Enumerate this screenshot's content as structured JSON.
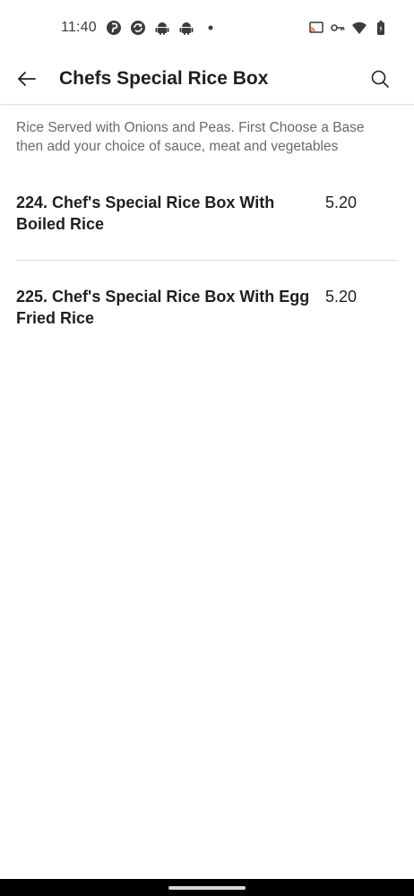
{
  "status_bar": {
    "time": "11:40",
    "left_icons": [
      "pinterest-icon",
      "sync-icon",
      "android-icon",
      "android-icon",
      "dot-icon"
    ],
    "right_icons": [
      "cast-icon",
      "vpn-key-icon",
      "wifi-icon",
      "battery-icon"
    ]
  },
  "header": {
    "title": "Chefs Special Rice Box",
    "back_icon": "arrow-left-icon",
    "search_icon": "search-icon"
  },
  "description": "Rice Served with Onions and Peas. First Choose a Base then add your choice of sauce, meat and vegetables",
  "items": [
    {
      "name": "224. Chef's Special Rice Box With Boiled Rice",
      "price": "5.20"
    },
    {
      "name": "225. Chef's Special Rice Box With Egg Fried Rice",
      "price": "5.20"
    }
  ],
  "colors": {
    "text_primary": "#1f1f1f",
    "text_secondary": "#6a6a6a",
    "divider": "#dcdcdc",
    "nav_bar": "#000000"
  }
}
